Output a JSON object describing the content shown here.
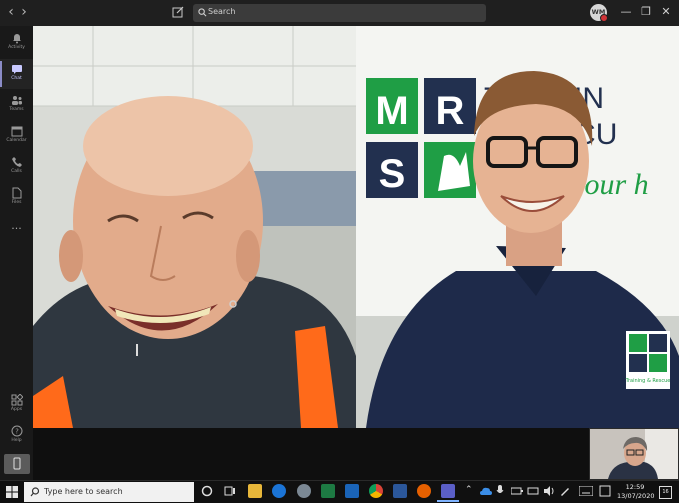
{
  "titlebar": {
    "back_glyph": "‹",
    "forward_glyph": "›",
    "search_placeholder": "Search",
    "user_initials": "WM",
    "minimize_glyph": "—",
    "restore_glyph": "❐",
    "close_glyph": "✕"
  },
  "rail": {
    "items": [
      {
        "label": "Activity",
        "icon": "bell-icon"
      },
      {
        "label": "Chat",
        "icon": "chat-icon"
      },
      {
        "label": "Teams",
        "icon": "teams-icon"
      },
      {
        "label": "Calendar",
        "icon": "calendar-icon"
      },
      {
        "label": "Calls",
        "icon": "phone-icon"
      },
      {
        "label": "Files",
        "icon": "file-icon"
      }
    ],
    "more_glyph": "···",
    "bottom_items": [
      {
        "label": "Apps",
        "icon": "apps-icon"
      },
      {
        "label": "Help",
        "icon": "help-icon"
      }
    ],
    "active": "Chat"
  },
  "logo": {
    "letters": [
      "M",
      "R",
      "S"
    ],
    "name_fragment_1": "TRAININ",
    "name_fragment_2": "& RESCU",
    "slogan_fragment": "Saving your h",
    "shirt_badge_caption": "Training & Rescue",
    "brand_green": "#1f9e45",
    "brand_navy": "#22304f"
  },
  "taskbar": {
    "search_placeholder": "Type here to search",
    "time": "12:59",
    "date": "13/07/2020",
    "notification_count": "16"
  },
  "colors": {
    "teams_bg": "#1f1f1f",
    "accent": "#8b8cc7",
    "hivis_orange": "#ff6a1a"
  }
}
